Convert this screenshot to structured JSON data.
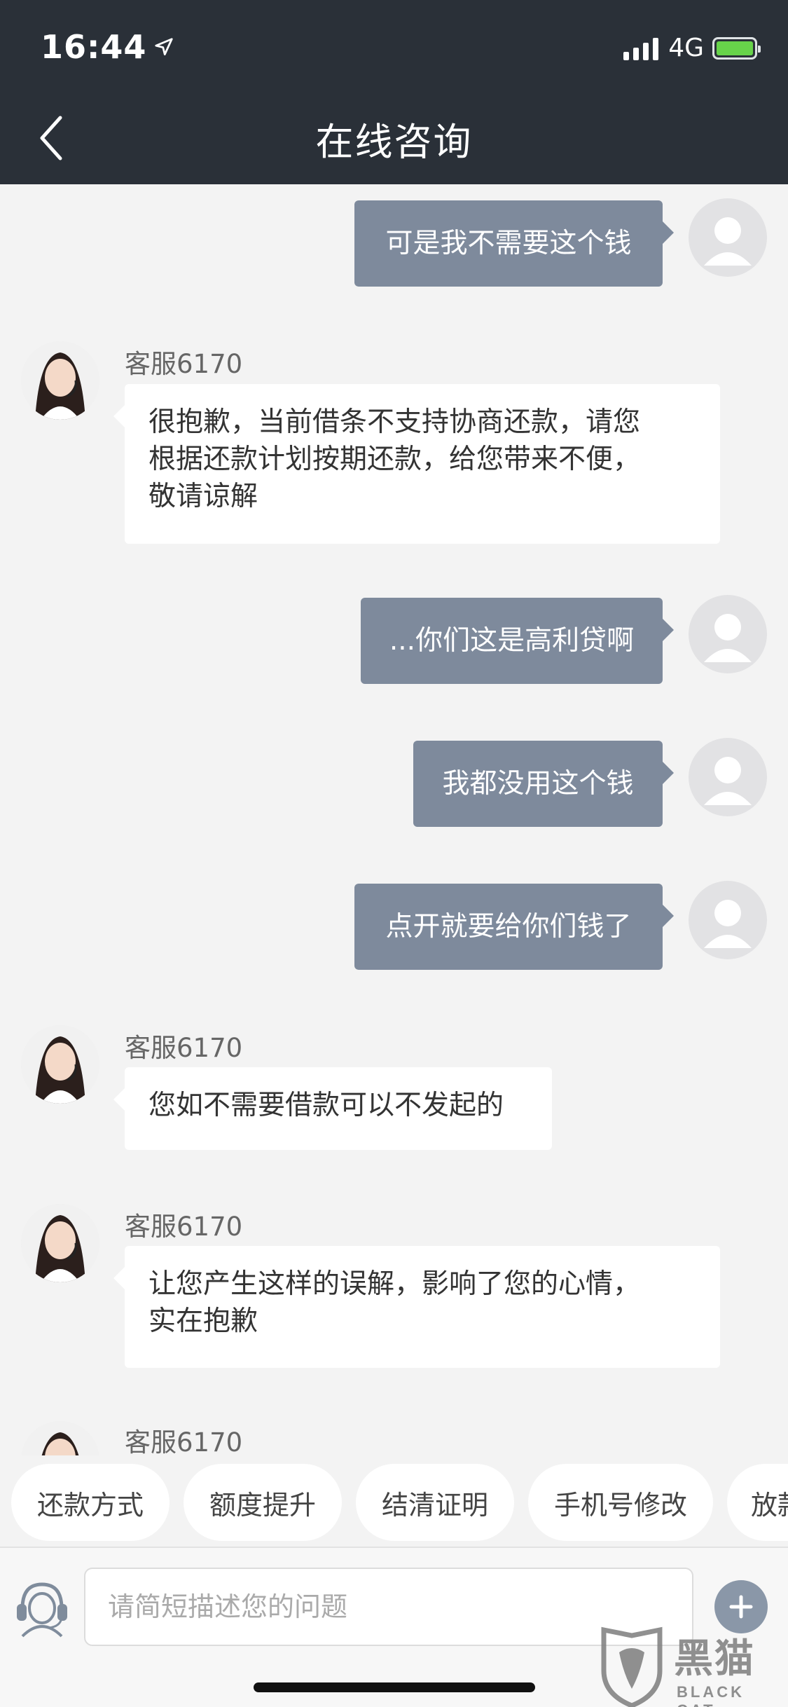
{
  "status_bar": {
    "time": "16:44",
    "network": "4G"
  },
  "header": {
    "title": "在线咨询"
  },
  "chat": {
    "agent_name": "客服6170",
    "messages": [
      {
        "from": "user",
        "text": "可是我不需要这个钱"
      },
      {
        "from": "agent",
        "lines": [
          "很抱歉，当前借条不支持协商还款，请您",
          "根据还款计划按期还款，给您带来不便，",
          "敬请谅解"
        ]
      },
      {
        "from": "user",
        "text": "...你们这是高利贷啊"
      },
      {
        "from": "user",
        "text": "我都没用这个钱"
      },
      {
        "from": "user",
        "text": "点开就要给你们钱了"
      },
      {
        "from": "agent",
        "lines": [
          "您如不需要借款可以不发起的"
        ]
      },
      {
        "from": "agent",
        "lines": [
          "让您产生这样的误解，影响了您的心情，",
          "实在抱歉"
        ]
      },
      {
        "from": "agent",
        "lines": []
      }
    ]
  },
  "quick_replies": [
    "还款方式",
    "额度提升",
    "结清证明",
    "手机号修改",
    "放款"
  ],
  "input": {
    "placeholder": "请简短描述您的问题"
  },
  "watermark": {
    "text": "黑猫",
    "sub": "BLACK CAT"
  },
  "colors": {
    "header_bg": "#2a3038",
    "user_bubble": "#7e8a9c",
    "agent_bubble": "#ffffff",
    "page_bg": "#f3f3f3"
  }
}
